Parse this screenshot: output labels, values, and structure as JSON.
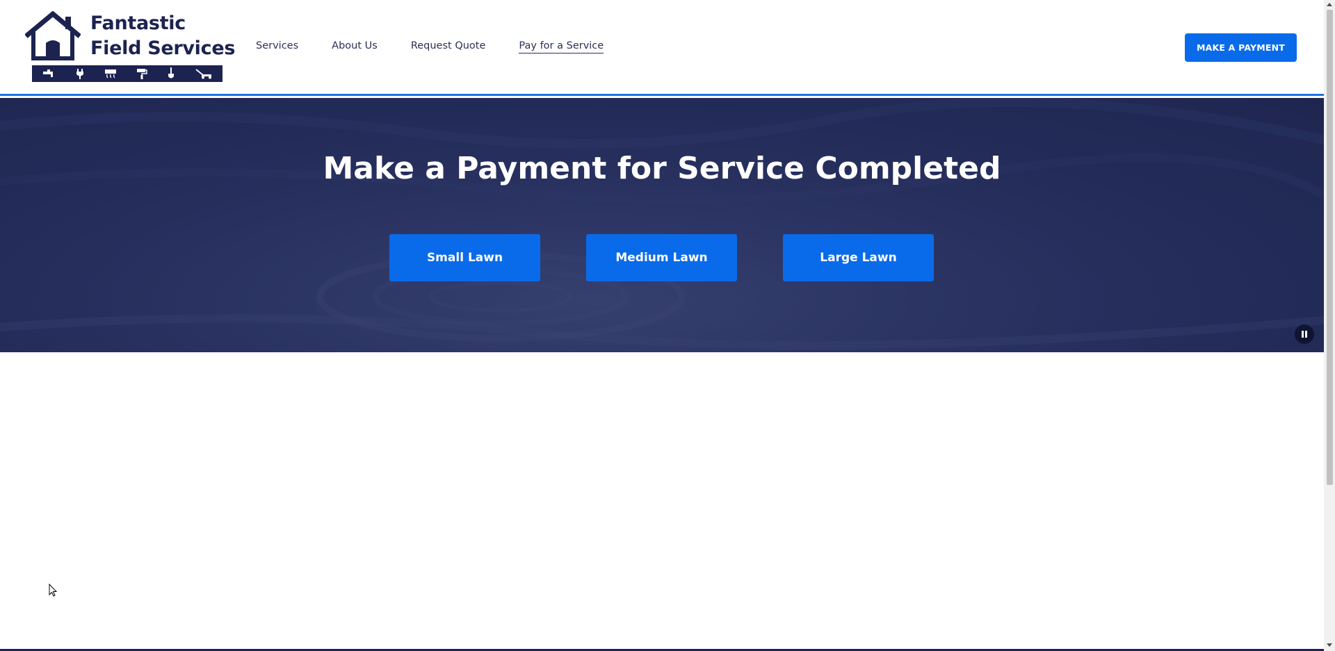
{
  "brand": {
    "name_line1": "Fantastic",
    "name_line2": "Field Services",
    "colors": {
      "navy": "#1c2350",
      "accent": "#0a6bea",
      "underline": "#1a73e8"
    },
    "service_icons": [
      "faucet-icon",
      "plug-icon",
      "hvac-icon",
      "paint-roller-icon",
      "shovel-icon",
      "lawn-mower-icon"
    ]
  },
  "nav": {
    "items": [
      {
        "label": "Services"
      },
      {
        "label": "About Us"
      },
      {
        "label": "Request Quote"
      },
      {
        "label": "Pay for a Service",
        "active": true
      }
    ]
  },
  "header": {
    "cta_label": "MAKE A PAYMENT"
  },
  "hero": {
    "title": "Make a Payment for Service Completed",
    "buttons": [
      {
        "label": "Small Lawn"
      },
      {
        "label": "Medium Lawn"
      },
      {
        "label": "Large Lawn"
      }
    ],
    "video_control": "pause-icon"
  }
}
